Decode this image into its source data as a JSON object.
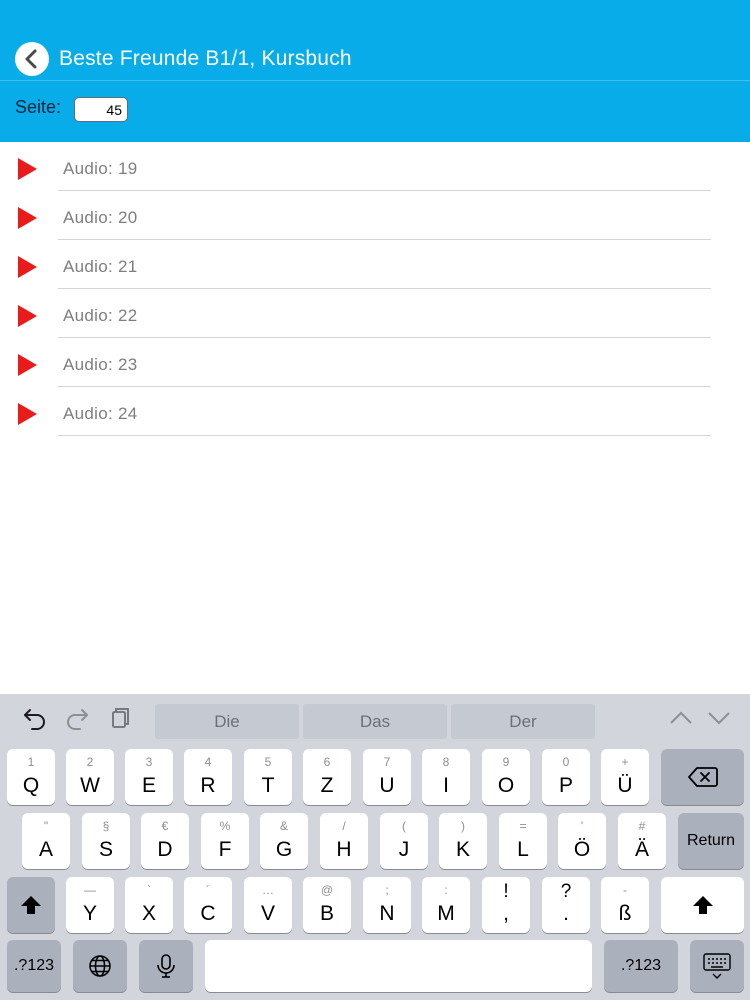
{
  "header": {
    "title": "Beste Freunde B1/1, Kursbuch",
    "page_label": "Seite:",
    "page_value": "45"
  },
  "list": [
    {
      "label": "Audio: 19"
    },
    {
      "label": "Audio: 20"
    },
    {
      "label": "Audio: 21"
    },
    {
      "label": "Audio: 22"
    },
    {
      "label": "Audio: 23"
    },
    {
      "label": "Audio: 24"
    }
  ],
  "keyboard": {
    "suggestions": [
      "Die",
      "Das",
      "Der"
    ],
    "row1": [
      {
        "main": "Q",
        "alt": "1"
      },
      {
        "main": "W",
        "alt": "2"
      },
      {
        "main": "E",
        "alt": "3"
      },
      {
        "main": "R",
        "alt": "4"
      },
      {
        "main": "T",
        "alt": "5"
      },
      {
        "main": "Z",
        "alt": "6"
      },
      {
        "main": "U",
        "alt": "7"
      },
      {
        "main": "I",
        "alt": "8"
      },
      {
        "main": "O",
        "alt": "9"
      },
      {
        "main": "P",
        "alt": "0"
      },
      {
        "main": "Ü",
        "alt": "+"
      }
    ],
    "row2": [
      {
        "main": "A",
        "alt": "\""
      },
      {
        "main": "S",
        "alt": "§"
      },
      {
        "main": "D",
        "alt": "€"
      },
      {
        "main": "F",
        "alt": "%"
      },
      {
        "main": "G",
        "alt": "&"
      },
      {
        "main": "H",
        "alt": "/"
      },
      {
        "main": "J",
        "alt": "("
      },
      {
        "main": "K",
        "alt": ")"
      },
      {
        "main": "L",
        "alt": "="
      },
      {
        "main": "Ö",
        "alt": "'"
      },
      {
        "main": "Ä",
        "alt": "#"
      }
    ],
    "row3": [
      {
        "main": "Y",
        "alt": "—"
      },
      {
        "main": "X",
        "alt": "`"
      },
      {
        "main": "C",
        "alt": "´"
      },
      {
        "main": "V",
        "alt": "…"
      },
      {
        "main": "B",
        "alt": "@"
      },
      {
        "main": "N",
        "alt": ";"
      },
      {
        "main": "M",
        "alt": ":"
      },
      {
        "main": ",",
        "alt": "!"
      },
      {
        "main": ".",
        "alt": "?"
      },
      {
        "main": "ß",
        "alt": "-"
      }
    ],
    "return_label": "Return",
    "numbers_label": ".?123",
    "space_label": ""
  },
  "colors": {
    "header_bg": "#08ace9",
    "play": "#ea1b1b",
    "keyboard_bg": "#d2d5db"
  }
}
